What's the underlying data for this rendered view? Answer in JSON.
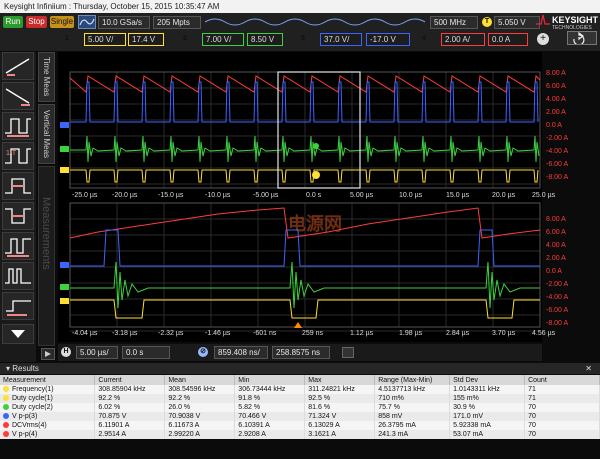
{
  "window": {
    "title": "Keysight Infiniium : Thursday, October 15, 2015 10:35:47 AM"
  },
  "brand": {
    "name": "KEYSIGHT",
    "sub": "TECHNOLOGIES"
  },
  "acquisition": {
    "run_label": "Run",
    "stop_label": "Stop",
    "single_label": "Single",
    "sample_rate": "10.0 GSa/s",
    "memory_depth": "205 Mpts",
    "bandwidth": "500 MHz",
    "trigger_level": "5.050 V",
    "trigger_badge": "T"
  },
  "channels": [
    {
      "id": "1",
      "scale": "5.00 V/",
      "offset": "17.4 V",
      "color": "#ffe033"
    },
    {
      "id": "2",
      "scale": "7.00 V/",
      "offset": "8.50 V",
      "color": "#3cd23c"
    },
    {
      "id": "3",
      "scale": "37.0 V/",
      "offset": "-17.0 V",
      "color": "#3c64ff",
      "tag": "1MΩ"
    },
    {
      "id": "4",
      "scale": "2.00 A/",
      "offset": "0.0 A",
      "color": "#ff3b3b"
    }
  ],
  "icons": {
    "add_channel": "plus-circle-icon",
    "measure": "ruler-icon",
    "undo": "undo-icon",
    "close": "close-icon"
  },
  "side_tabs": {
    "time_meas": "Time Meas",
    "vertical_meas": "Vertical Meas",
    "measurements_watermark": "Measurements"
  },
  "upper_grid": {
    "x_ticks": [
      "-25.0 µs",
      "-20.0 µs",
      "-15.0 µs",
      "-10.0 µs",
      "-5.00 µs",
      "0.0 s",
      "5.00 µs",
      "10.0 µs",
      "15.0 µs",
      "20.0 µs",
      "25.0 µs"
    ],
    "right_labels": [
      "8.00 A",
      "6.00 A",
      "4.00 A",
      "2.00 A",
      "0.0 A",
      "-2.00 A",
      "-4.00 A",
      "-6.00 A",
      "-8.00 A"
    ]
  },
  "lower_grid": {
    "x_ticks": [
      "-4.04 µs",
      "-3.18 µs",
      "-2.32 µs",
      "-1.46 µs",
      "-601 ns",
      "259 ns",
      "1.12 µs",
      "1.98 µs",
      "2.84 µs",
      "3.70 µs",
      "4.56 µs"
    ],
    "right_labels": [
      "8.00 A",
      "6.00 A",
      "4.00 A",
      "2.00 A",
      "0.0 A",
      "-2.00 A",
      "-4.00 A",
      "-6.00 A",
      "-8.00 A"
    ],
    "watermark": "电源网"
  },
  "timebase": {
    "badge": "H",
    "scale": "5.00 µs/",
    "position": "0.0 s",
    "zoom_badge": "⊘",
    "zoom_scale": "859.408 ns/",
    "zoom_position": "258.8575 ns"
  },
  "results": {
    "title": "Results",
    "columns": [
      "Measurement",
      "Current",
      "Mean",
      "Min",
      "Max",
      "Range (Max-Min)",
      "Std Dev",
      "Count"
    ],
    "rows": [
      {
        "ch": "1",
        "name": "Frequency(1)",
        "current": "308.85904 kHz",
        "mean": "308.54596 kHz",
        "min": "306.73444 kHz",
        "max": "311.24821 kHz",
        "range": "4.5137713 kHz",
        "std": "1.0143311 kHz",
        "count": "71"
      },
      {
        "ch": "1",
        "name": "Duty cycle(1)",
        "current": "92.2 %",
        "mean": "92.2 %",
        "min": "91.8 %",
        "max": "92.5 %",
        "range": "710 m%",
        "std": "155 m%",
        "count": "71"
      },
      {
        "ch": "2",
        "name": "Duty cycle(2)",
        "current": "6.02 %",
        "mean": "26.0 %",
        "min": "5.82 %",
        "max": "81.6 %",
        "range": "75.7 %",
        "std": "30.9 %",
        "count": "70"
      },
      {
        "ch": "3",
        "name": "V p-p(3)",
        "current": "70.875 V",
        "mean": "70.9038 V",
        "min": "70.466 V",
        "max": "71.324 V",
        "range": "858 mV",
        "std": "171.0 mV",
        "count": "70"
      },
      {
        "ch": "4",
        "name": "DCVrms(4)",
        "current": "6.11901 A",
        "mean": "6.11673 A",
        "min": "6.10391 A",
        "max": "6.13029 A",
        "range": "26.3795 mA",
        "std": "5.92338 mA",
        "count": "70"
      },
      {
        "ch": "4",
        "name": "V p-p(4)",
        "current": "2.9514 A",
        "mean": "2.99220 A",
        "min": "2.9208 A",
        "max": "3.1621 A",
        "range": "241.3 mA",
        "std": "53.07 mA",
        "count": "70"
      }
    ]
  }
}
